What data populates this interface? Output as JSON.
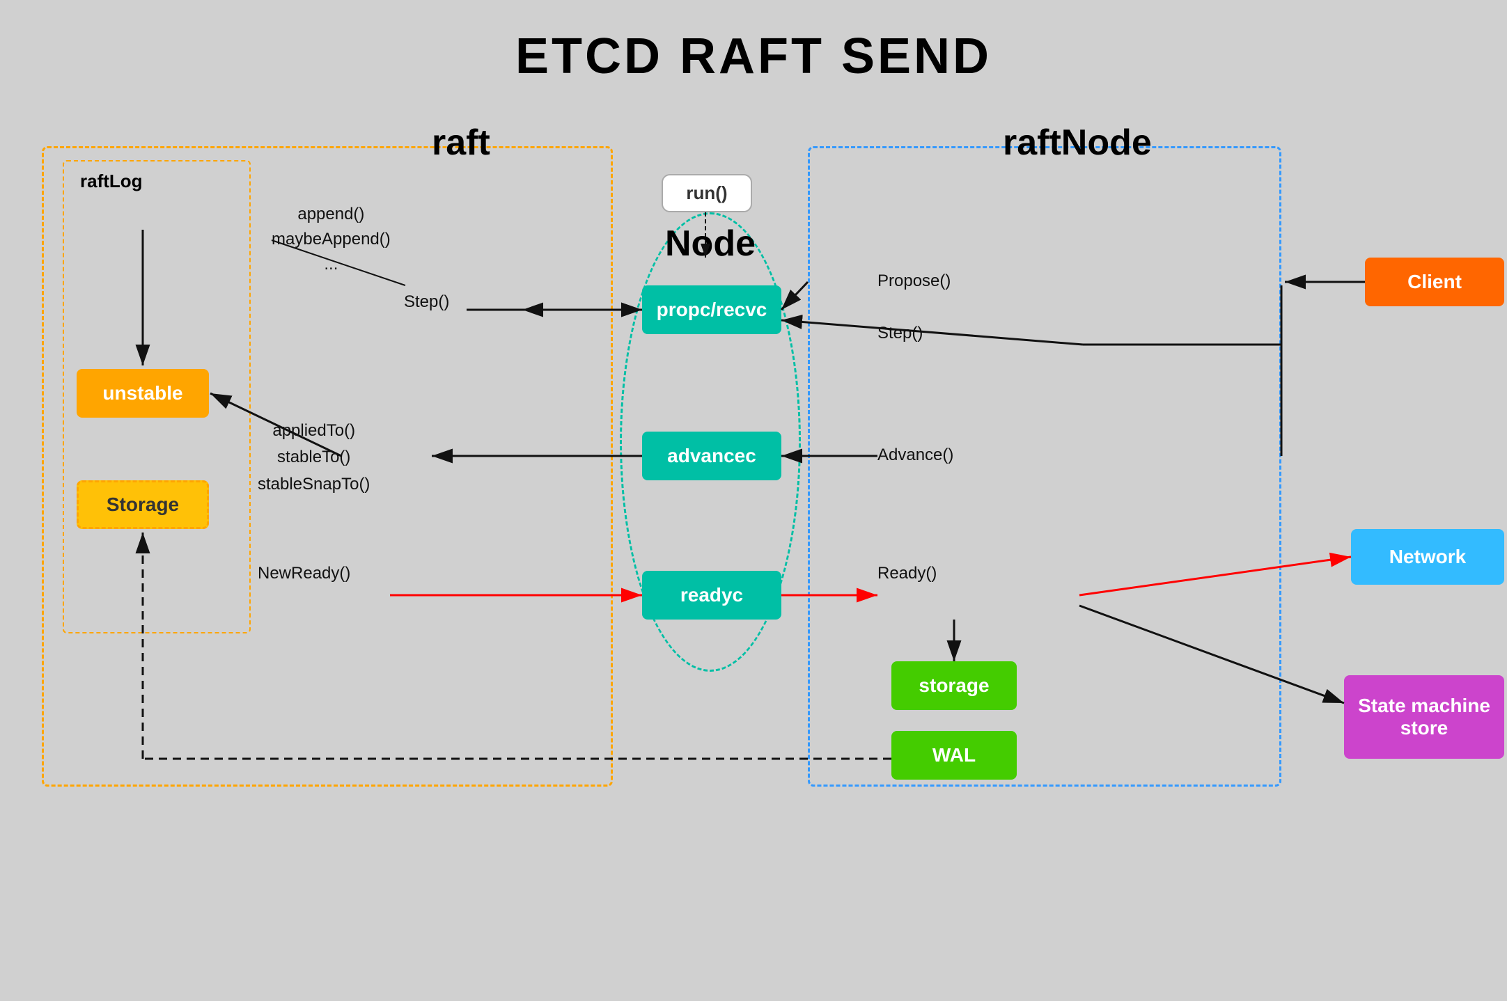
{
  "title": "ETCD RAFT SEND",
  "labels": {
    "raft": "raft",
    "raftNode": "raftNode",
    "raftLog": "raftLog",
    "node": "Node",
    "run": "run()",
    "propc": "propc/recvc",
    "advancec": "advancec",
    "readyc": "readyc",
    "unstable": "unstable",
    "storage": "Storage",
    "client": "Client",
    "network": "Network",
    "stateMachineStore": "State machine\nstore",
    "storage2": "storage",
    "wal": "WAL"
  },
  "methods": {
    "append": "append()\nmaybeAppend()\n...",
    "step1": "Step()",
    "appliedTo": "appliedTo()\nstableTo()\nstableSnapTo()",
    "newReady": "NewReady()",
    "propose": "Propose()",
    "step2": "Step()",
    "advance": "Advance()",
    "ready": "Ready()"
  }
}
